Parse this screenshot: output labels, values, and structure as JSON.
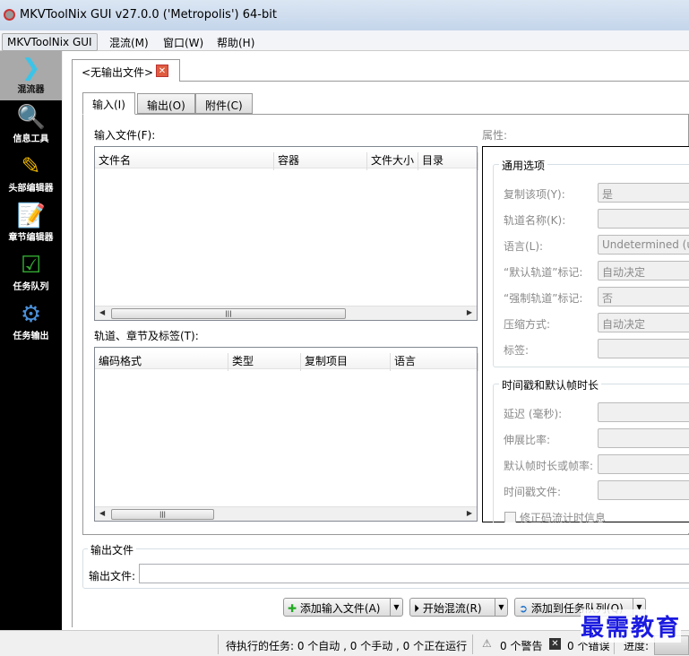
{
  "window": {
    "title": "MKVToolNix GUI v27.0.0 ('Metropolis') 64-bit"
  },
  "menu": [
    "MKVToolNix GUI",
    "混流(M)",
    "窗口(W)",
    "帮助(H)"
  ],
  "sidebar": [
    {
      "label": "混流器",
      "icon": "mixer-icon"
    },
    {
      "label": "信息工具",
      "icon": "magnifier-icon"
    },
    {
      "label": "头部编辑器",
      "icon": "pencil-icon"
    },
    {
      "label": "章节编辑器",
      "icon": "notepad-icon"
    },
    {
      "label": "任务队列",
      "icon": "checklist-icon"
    },
    {
      "label": "任务输出",
      "icon": "gear-icon"
    }
  ],
  "doc_tab": "<无输出文件>",
  "tabs": [
    "输入(I)",
    "输出(O)",
    "附件(C)"
  ],
  "input_files": {
    "label": "输入文件(F):",
    "columns": [
      "文件名",
      "容器",
      "文件大小",
      "目录"
    ]
  },
  "tracks": {
    "label": "轨道、章节及标签(T):",
    "columns": [
      "编码格式",
      "类型",
      "复制项目",
      "语言"
    ]
  },
  "properties": {
    "label": "属性:",
    "general": {
      "title": "通用选项",
      "rows": [
        {
          "label": "复制该项(Y):",
          "value": "是"
        },
        {
          "label": "轨道名称(K):",
          "value": ""
        },
        {
          "label": "语言(L):",
          "value": "Undetermined (und)"
        },
        {
          "label": "“默认轨道”标记:",
          "value": "自动决定"
        },
        {
          "label": "“强制轨道”标记:",
          "value": "否"
        },
        {
          "label": "压缩方式:",
          "value": "自动决定"
        },
        {
          "label": "标签:",
          "value": ""
        }
      ]
    },
    "timing": {
      "title": "时间戳和默认帧时长",
      "rows": [
        {
          "label": "延迟 (毫秒):",
          "value": ""
        },
        {
          "label": "伸展比率:",
          "value": ""
        },
        {
          "label": "默认帧时长或帧率:",
          "value": ""
        },
        {
          "label": "时间戳文件:",
          "value": ""
        }
      ],
      "checkbox": "修正码流计时信息"
    }
  },
  "output": {
    "group": "输出文件",
    "label": "输出文件:",
    "value": ""
  },
  "buttons": {
    "add_input": "添加输入文件(A)",
    "start_mux": "开始混流(R)",
    "add_queue": "添加到任务队列(Q)"
  },
  "status": {
    "jobs": "待执行的任务: 0 个自动 , 0 个手动 , 0 个正在运行",
    "warnings": "0 个警告",
    "errors": "0 个错误",
    "progress": "进度:"
  },
  "watermark": "最需教育"
}
